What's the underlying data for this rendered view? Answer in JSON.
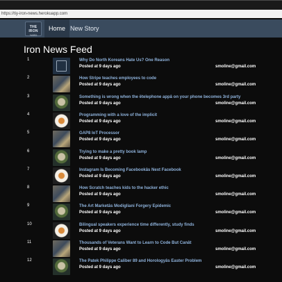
{
  "browser": {
    "url": "https://tiy-iron-news.herokuapp.com"
  },
  "nav": {
    "logo_line1": "THE IRON",
    "logo_line2": "YARD",
    "home": "Home",
    "new_story": "New Story"
  },
  "feed": {
    "title": "Iron News Feed",
    "items": [
      {
        "rank": "1",
        "title": "Why Do North Koreans Hate Us? One Reason",
        "posted": "Posted at 9 days ago",
        "email": "smoline@gmail.com",
        "thumb": "logo"
      },
      {
        "rank": "2",
        "title": "How Stripe teaches employees to code",
        "posted": "Posted at 9 days ago",
        "email": "smoline@gmail.com",
        "thumb": "build"
      },
      {
        "rank": "3",
        "title": "Something is wrong when the ëtelephone appâ on your phone becomes 3rd party",
        "posted": "Posted at 9 days ago",
        "email": "smoline@gmail.com",
        "thumb": "plant"
      },
      {
        "rank": "4",
        "title": "Programming with a love of the implicit",
        "posted": "Posted at 9 days ago",
        "email": "smoline@gmail.com",
        "thumb": "cup"
      },
      {
        "rank": "5",
        "title": "GAP8 IoT Processor",
        "posted": "Posted at 9 days ago",
        "email": "smoline@gmail.com",
        "thumb": "build"
      },
      {
        "rank": "6",
        "title": "Trying to make a pretty book lamp",
        "posted": "Posted at 9 days ago",
        "email": "smoline@gmail.com",
        "thumb": "plant"
      },
      {
        "rank": "7",
        "title": "Instagram Is Becoming Facebookâs Next Facebook",
        "posted": "Posted at 9 days ago",
        "email": "smoline@gmail.com",
        "thumb": "cup"
      },
      {
        "rank": "8",
        "title": "How Scratch teaches kids to the hacker ethic",
        "posted": "Posted at 9 days ago",
        "email": "smoline@gmail.com",
        "thumb": "build"
      },
      {
        "rank": "9",
        "title": "The Art Marketâs Modigliani Forgery Epidemic",
        "posted": "Posted at 9 days ago",
        "email": "smoline@gmail.com",
        "thumb": "plant"
      },
      {
        "rank": "10",
        "title": "Bilingual speakers experience time differently, study finds",
        "posted": "Posted at 9 days ago",
        "email": "smoline@gmail.com",
        "thumb": "cup"
      },
      {
        "rank": "11",
        "title": "Thousands of Veterans Want to Learn to Code But Canât",
        "posted": "Posted at 9 days ago",
        "email": "smoline@gmail.com",
        "thumb": "build"
      },
      {
        "rank": "12",
        "title": "The Patek Philippe Caliber 89 and Horologyâs Easter Problem",
        "posted": "Posted at 9 days ago",
        "email": "smoline@gmail.com",
        "thumb": "plant"
      }
    ]
  }
}
